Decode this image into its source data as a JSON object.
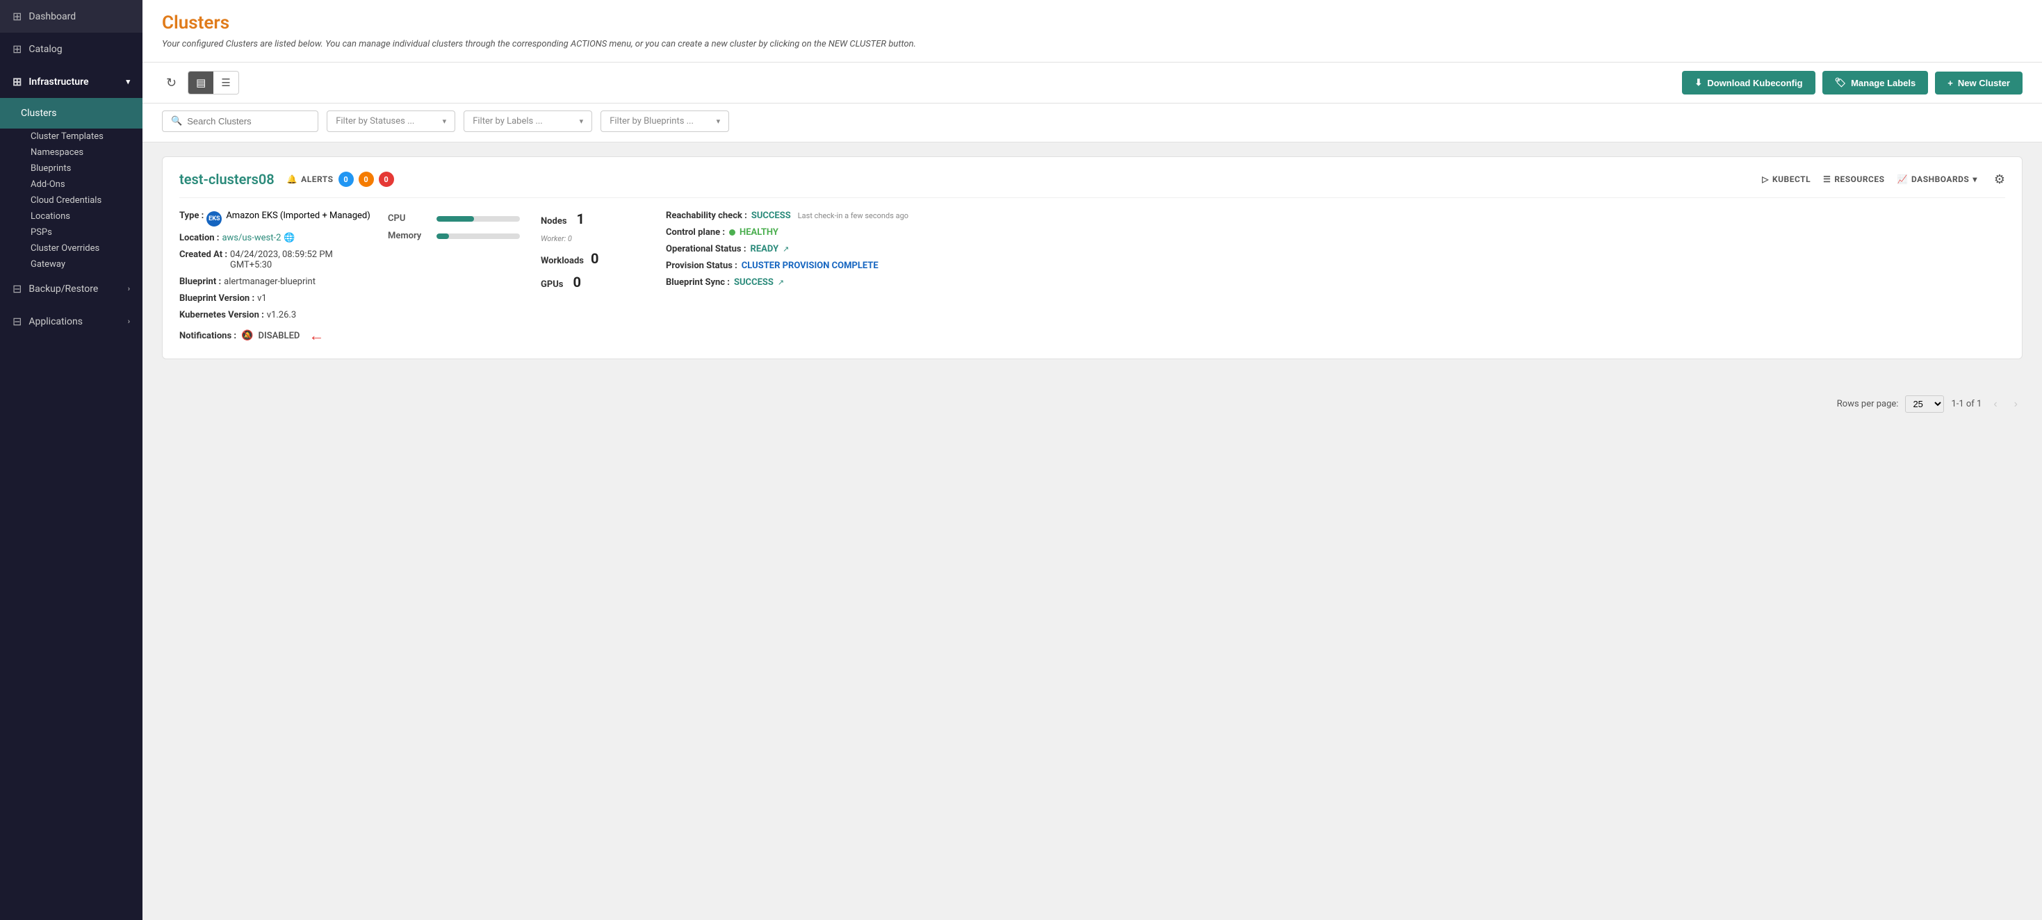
{
  "sidebar": {
    "items": [
      {
        "id": "dashboard",
        "label": "Dashboard",
        "icon": "⊞",
        "active": false
      },
      {
        "id": "catalog",
        "label": "Catalog",
        "icon": "⊞",
        "active": false
      },
      {
        "id": "infrastructure",
        "label": "Infrastructure",
        "icon": "⊞",
        "active": false,
        "expanded": true
      },
      {
        "id": "clusters",
        "label": "Clusters",
        "icon": "",
        "active": true
      },
      {
        "id": "cluster-templates",
        "label": "Cluster Templates",
        "icon": "",
        "active": false
      },
      {
        "id": "namespaces",
        "label": "Namespaces",
        "icon": "",
        "active": false
      },
      {
        "id": "blueprints",
        "label": "Blueprints",
        "icon": "",
        "active": false
      },
      {
        "id": "add-ons",
        "label": "Add-Ons",
        "icon": "",
        "active": false
      },
      {
        "id": "cloud-credentials",
        "label": "Cloud Credentials",
        "icon": "",
        "active": false
      },
      {
        "id": "locations",
        "label": "Locations",
        "icon": "",
        "active": false
      },
      {
        "id": "psps",
        "label": "PSPs",
        "icon": "",
        "active": false
      },
      {
        "id": "cluster-overrides",
        "label": "Cluster Overrides",
        "icon": "",
        "active": false
      },
      {
        "id": "gateway",
        "label": "Gateway",
        "icon": "",
        "active": false
      },
      {
        "id": "backup-restore",
        "label": "Backup/Restore",
        "icon": "⊟",
        "active": false,
        "hasChevron": true
      },
      {
        "id": "applications",
        "label": "Applications",
        "icon": "⊟",
        "active": false,
        "hasChevron": true
      }
    ]
  },
  "page": {
    "title": "Clusters",
    "description": "Your configured Clusters are listed below. You can manage individual clusters through the corresponding ACTIONS menu, or you can create a new cluster by clicking on the NEW CLUSTER button."
  },
  "toolbar": {
    "download_kubeconfig": "Download Kubeconfig",
    "manage_labels": "Manage Labels",
    "new_cluster": "New Cluster"
  },
  "filters": {
    "search_placeholder": "Search Clusters",
    "status_placeholder": "Filter by Statuses ...",
    "labels_placeholder": "Filter by Labels ...",
    "blueprints_placeholder": "Filter by Blueprints ..."
  },
  "clusters": [
    {
      "name": "test-clusters08",
      "alerts": {
        "blue": 0,
        "orange": 0,
        "red": 0
      },
      "type": "Amazon EKS (Imported + Managed)",
      "location": "aws/us-west-2",
      "created_at": "04/24/2023, 08:59:52 PM GMT+5:30",
      "blueprint": "alertmanager-blueprint",
      "blueprint_version": "v1",
      "kubernetes_version": "v1.26.3",
      "notifications": "DISABLED",
      "cpu_percent": 45,
      "memory_percent": 15,
      "nodes": 1,
      "workers": 0,
      "workloads": 0,
      "gpus": 0,
      "reachability": "SUCCESS",
      "checkin_text": "Last check-in  a few seconds ago",
      "control_plane": "HEALTHY",
      "operational_status": "READY",
      "provision_status": "CLUSTER PROVISION COMPLETE",
      "blueprint_sync": "SUCCESS"
    }
  ],
  "pagination": {
    "rows_per_page_label": "Rows per page:",
    "rows_per_page": "25",
    "range": "1-1 of 1"
  }
}
